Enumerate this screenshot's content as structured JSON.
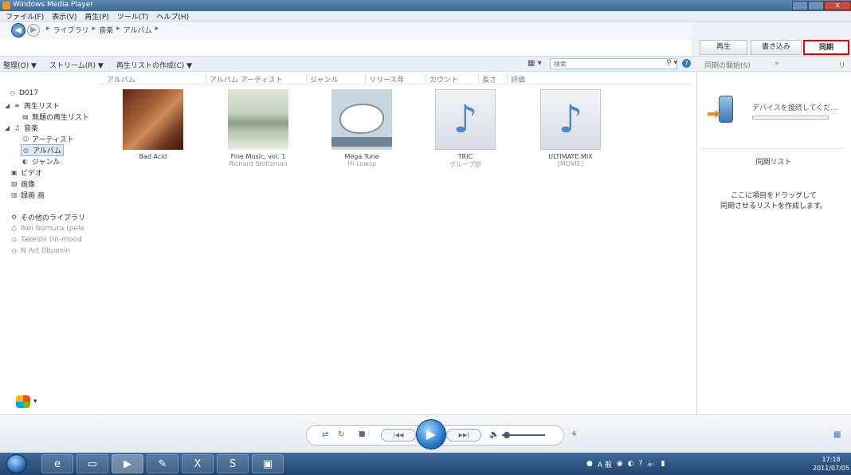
{
  "window": {
    "title": "Windows Media Player",
    "close_glyph": "x"
  },
  "menu": [
    "ファイル(F)",
    "表示(V)",
    "再生(P)",
    "ツール(T)",
    "ヘルプ(H)"
  ],
  "breadcrumb": [
    "ライブラリ",
    "音楽",
    "アルバム"
  ],
  "tabs": {
    "play": "再生",
    "burn": "書き込み",
    "sync": "同期"
  },
  "toolbar": {
    "organize": "整理(O) ▼",
    "stream": "ストリーム(R) ▼",
    "create_playlist": "再生リストの作成(C) ▼",
    "search_placeholder": "検索"
  },
  "right_toolbar": {
    "sync_options": "同期の開始(S)",
    "more": "»",
    "list": "リス"
  },
  "columns": [
    "アルバム",
    "アルバム アーティスト",
    "ジャンル",
    "リリース年",
    "カウント",
    "長さ",
    "評価"
  ],
  "nav": {
    "user": "D017",
    "playlists": "再生リスト",
    "unsaved_playlist": "無題の再生リスト",
    "music": "音楽",
    "artist": "アーティスト",
    "album": "アルバム",
    "genre": "ジャンル",
    "video": "ビデオ",
    "pictures": "画像",
    "recorded_tv": "録画 画",
    "other_libraries": "その他のライブラリ",
    "other_1": "Ikei Nomura (pele",
    "other_2": "Takeshi (m-mood",
    "other_3": "N Art (Ibunsin"
  },
  "albums": [
    {
      "title": "Bad Acid",
      "artist": ""
    },
    {
      "title": "Fine Music, vol. 1",
      "artist": "Richard Stoltzman"
    },
    {
      "title": "Mega Tune",
      "artist": "Hi-Lowsp"
    },
    {
      "title": "TRIC",
      "artist": "グループ部"
    },
    {
      "title": "ULTIMATE MIX",
      "artist": "[MOVIE]"
    }
  ],
  "sync_panel": {
    "device_text": "デバイスを接続してくだ...",
    "sync_list": "同期リスト",
    "drag_hint_1": "ここに項目をドラッグして",
    "drag_hint_2": "同期させるリストを作成します。"
  },
  "controls": {
    "shuffle": "⇄",
    "repeat": "↻",
    "stop": "■",
    "prev": "|◀◀",
    "play": "▶",
    "next": "▶▶|",
    "mute": "🔈"
  },
  "clock": {
    "time": "17:18",
    "date": "2011/07/05"
  },
  "tray_text": "A 般",
  "colors": {
    "sync_highlight": "#e00000",
    "accent": "#2677c9"
  }
}
